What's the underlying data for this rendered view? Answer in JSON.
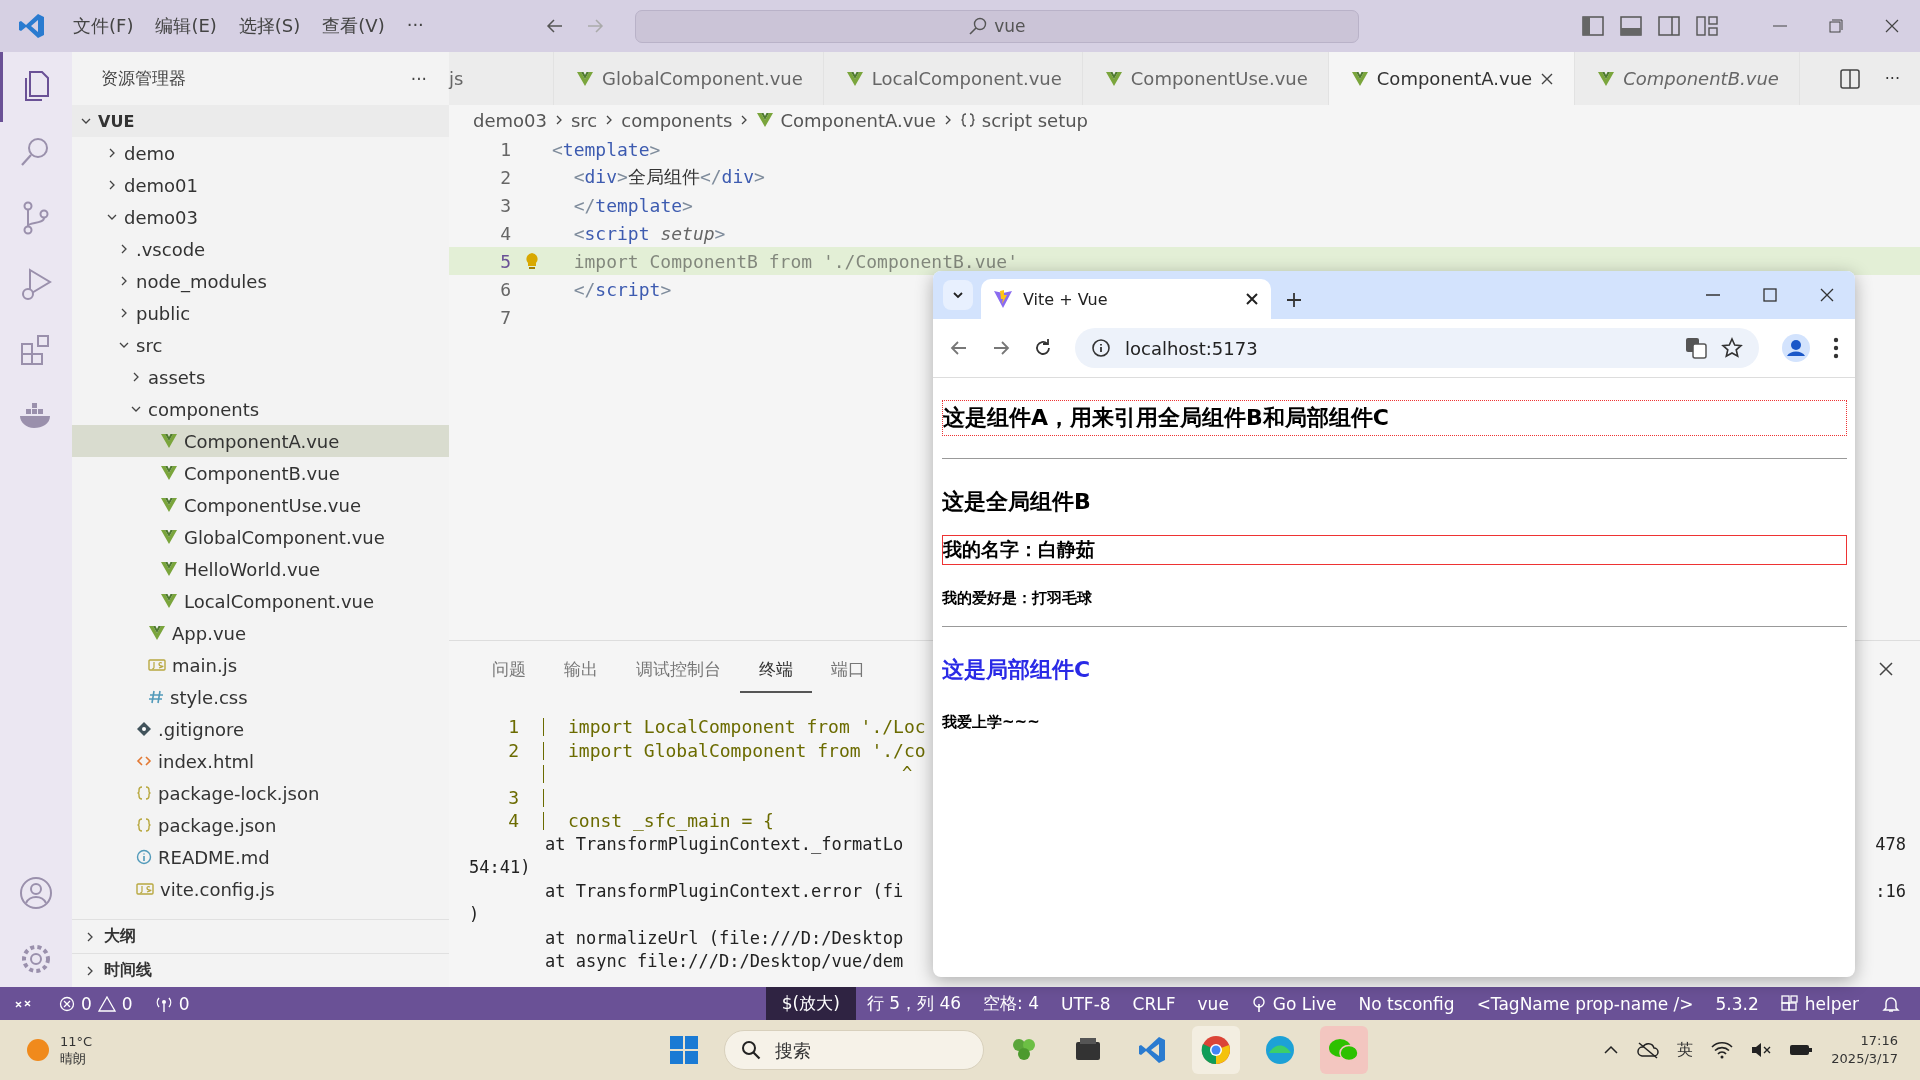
{
  "title_bar": {
    "menu": [
      "文件(F)",
      "编辑(E)",
      "选择(S)",
      "查看(V)",
      "···"
    ],
    "search": {
      "value": "vue"
    }
  },
  "sidebar": {
    "title": "资源管理器",
    "more": "···",
    "tree": [
      {
        "label": "VUE",
        "kind": "root",
        "expanded": true,
        "children": [
          {
            "label": "demo",
            "kind": "folder",
            "expanded": false,
            "selected": false
          },
          {
            "label": "demo01",
            "kind": "folder",
            "expanded": false,
            "selected": false
          },
          {
            "label": "demo03",
            "kind": "folder",
            "expanded": true,
            "selected": false,
            "children": [
              {
                "label": ".vscode",
                "kind": "folder",
                "expanded": false,
                "selected": false
              },
              {
                "label": "node_modules",
                "kind": "folder",
                "expanded": false,
                "selected": false
              },
              {
                "label": "public",
                "kind": "folder",
                "expanded": false,
                "selected": false
              },
              {
                "label": "src",
                "kind": "folder",
                "expanded": true,
                "selected": false,
                "children": [
                  {
                    "label": "assets",
                    "kind": "folder",
                    "expanded": false,
                    "selected": false
                  },
                  {
                    "label": "components",
                    "kind": "folder",
                    "expanded": true,
                    "selected": false,
                    "children": [
                      {
                        "label": "ComponentA.vue",
                        "kind": "vue",
                        "selected": true
                      },
                      {
                        "label": "ComponentB.vue",
                        "kind": "vue",
                        "selected": false
                      },
                      {
                        "label": "ComponentUse.vue",
                        "kind": "vue",
                        "selected": false
                      },
                      {
                        "label": "GlobalComponent.vue",
                        "kind": "vue",
                        "selected": false
                      },
                      {
                        "label": "HelloWorld.vue",
                        "kind": "vue",
                        "selected": false
                      },
                      {
                        "label": "LocalComponent.vue",
                        "kind": "vue",
                        "selected": false
                      }
                    ]
                  },
                  {
                    "label": "App.vue",
                    "kind": "vue",
                    "selected": false
                  },
                  {
                    "label": "main.js",
                    "kind": "js",
                    "selected": false
                  },
                  {
                    "label": "style.css",
                    "kind": "css",
                    "selected": false
                  }
                ]
              },
              {
                "label": ".gitignore",
                "kind": "git",
                "selected": false
              },
              {
                "label": "index.html",
                "kind": "html",
                "selected": false
              },
              {
                "label": "package-lock.json",
                "kind": "json",
                "selected": false
              },
              {
                "label": "package.json",
                "kind": "json",
                "selected": false
              },
              {
                "label": "README.md",
                "kind": "info",
                "selected": false
              },
              {
                "label": "vite.config.js",
                "kind": "js",
                "selected": false
              }
            ]
          }
        ]
      }
    ],
    "sections": [
      {
        "label": "大纲",
        "expanded": false
      },
      {
        "label": "时间线",
        "expanded": false
      }
    ]
  },
  "editor": {
    "tabs": [
      {
        "label": "js",
        "kind": "plain",
        "selected": false,
        "preview": false
      },
      {
        "label": "GlobalComponent.vue",
        "kind": "vue",
        "selected": false,
        "preview": false
      },
      {
        "label": "LocalComponent.vue",
        "kind": "vue",
        "selected": false,
        "preview": false
      },
      {
        "label": "ComponentUse.vue",
        "kind": "vue",
        "selected": false,
        "preview": false
      },
      {
        "label": "ComponentA.vue",
        "kind": "vue",
        "selected": true,
        "preview": false
      },
      {
        "label": "ComponentB.vue",
        "kind": "vue",
        "selected": false,
        "preview": true
      }
    ],
    "more": "···",
    "breadcrumb": [
      {
        "label": "demo03",
        "kind": "plain"
      },
      {
        "label": "src",
        "kind": "plain"
      },
      {
        "label": "components",
        "kind": "plain"
      },
      {
        "label": "ComponentA.vue",
        "kind": "vue"
      },
      {
        "label": "script setup",
        "kind": "braces"
      }
    ],
    "lines": [
      {
        "number": "1",
        "current": false,
        "faded": false,
        "segments": [
          {
            "text": "<",
            "kind": "punct"
          },
          {
            "text": "template",
            "kind": "tag"
          },
          {
            "text": ">",
            "kind": "punct"
          }
        ]
      },
      {
        "number": "2",
        "current": false,
        "faded": false,
        "segments": [
          {
            "text": "  <",
            "kind": "punct"
          },
          {
            "text": "div",
            "kind": "tag"
          },
          {
            "text": ">",
            "kind": "punct"
          },
          {
            "text": "全局组件",
            "kind": "text"
          },
          {
            "text": "</",
            "kind": "punct"
          },
          {
            "text": "div",
            "kind": "tag"
          },
          {
            "text": ">",
            "kind": "punct"
          }
        ]
      },
      {
        "number": "3",
        "current": false,
        "faded": false,
        "segments": [
          {
            "text": "  </",
            "kind": "punct"
          },
          {
            "text": "template",
            "kind": "tag"
          },
          {
            "text": ">",
            "kind": "punct"
          }
        ]
      },
      {
        "number": "4",
        "current": false,
        "faded": false,
        "segments": [
          {
            "text": "  <",
            "kind": "punct"
          },
          {
            "text": "script",
            "kind": "tag"
          },
          {
            "text": " setup",
            "kind": "attr"
          },
          {
            "text": ">",
            "kind": "punct"
          }
        ]
      },
      {
        "number": "5",
        "current": true,
        "faded": true,
        "segments": [
          {
            "text": "  import ComponentB from './ComponentB.vue'",
            "kind": "text"
          }
        ]
      },
      {
        "number": "6",
        "current": false,
        "faded": false,
        "segments": [
          {
            "text": "  </",
            "kind": "punct"
          },
          {
            "text": "script",
            "kind": "tag"
          },
          {
            "text": ">",
            "kind": "punct"
          }
        ]
      },
      {
        "number": "7",
        "current": false
      }
    ]
  },
  "panel": {
    "tabs": [
      {
        "label": "问题",
        "selected": false
      },
      {
        "label": "输出",
        "selected": false
      },
      {
        "label": "调试控制台",
        "selected": false
      },
      {
        "label": "终端",
        "selected": true
      },
      {
        "label": "端口",
        "selected": false
      }
    ],
    "terminal": [
      {
        "kind": "code",
        "number": "1",
        "text": "import LocalComponent from './Loc"
      },
      {
        "kind": "code",
        "number": "2",
        "text": "import GlobalComponent from './co"
      },
      {
        "kind": "caret",
        "text": "^"
      },
      {
        "kind": "code",
        "number": "3"
      },
      {
        "kind": "code",
        "number": "4",
        "text": "const _sfc_main = {"
      },
      {
        "kind": "stack",
        "text": "at TransformPluginContext._formatLo",
        "tail": "478"
      },
      {
        "kind": "wrap",
        "text": "54:41)"
      },
      {
        "kind": "stack",
        "text": "at TransformPluginContext.error (fi",
        "tail": ":16"
      },
      {
        "kind": "wrap",
        "text": ")"
      },
      {
        "kind": "stack",
        "text": "at normalizeUrl (file:///D:/Desktop"
      },
      {
        "kind": "stack",
        "text": "at async file:///D:/Desktop/vue/dem"
      }
    ]
  },
  "status_bar": {
    "problems": {
      "errors": "0",
      "warnings": "0"
    },
    "ports": "0",
    "items": [
      {
        "label": "$(放大)",
        "kind": "dark"
      },
      {
        "label": "行 5，列 46",
        "kind": "plain"
      },
      {
        "label": "空格: 4",
        "kind": "plain"
      },
      {
        "label": "UTF-8",
        "kind": "plain"
      },
      {
        "label": "CRLF",
        "kind": "plain"
      },
      {
        "label": "vue",
        "kind": "plain"
      },
      {
        "label": "Go Live",
        "kind": "live"
      },
      {
        "label": "No tsconfig",
        "kind": "plain"
      },
      {
        "label": "<TagName prop-name />",
        "kind": "plain"
      },
      {
        "label": "5.3.2",
        "kind": "plain"
      },
      {
        "label": "helper",
        "kind": "helper"
      }
    ]
  },
  "browser": {
    "tab": {
      "title": "Vite + Vue"
    },
    "address": "localhost:5173",
    "content": [
      {
        "kind": "title",
        "text": "这是组件A，用来引用全局组件B和局部组件C"
      },
      {
        "kind": "rule"
      },
      {
        "kind": "heading",
        "text": "这是全局组件B"
      },
      {
        "kind": "boxed",
        "text": "我的名字：白静茹"
      },
      {
        "kind": "small",
        "text": "我的爱好是：打羽毛球"
      },
      {
        "kind": "rule"
      },
      {
        "kind": "blue",
        "text": "这是局部组件C"
      },
      {
        "kind": "small",
        "text": "我爱上学~~~"
      }
    ]
  },
  "taskbar": {
    "weather": {
      "temp": "11°C",
      "desc": "晴朗"
    },
    "search": {
      "placeholder": "搜索"
    },
    "ime": "英",
    "time": "17:16",
    "date": "2025/3/17"
  }
}
